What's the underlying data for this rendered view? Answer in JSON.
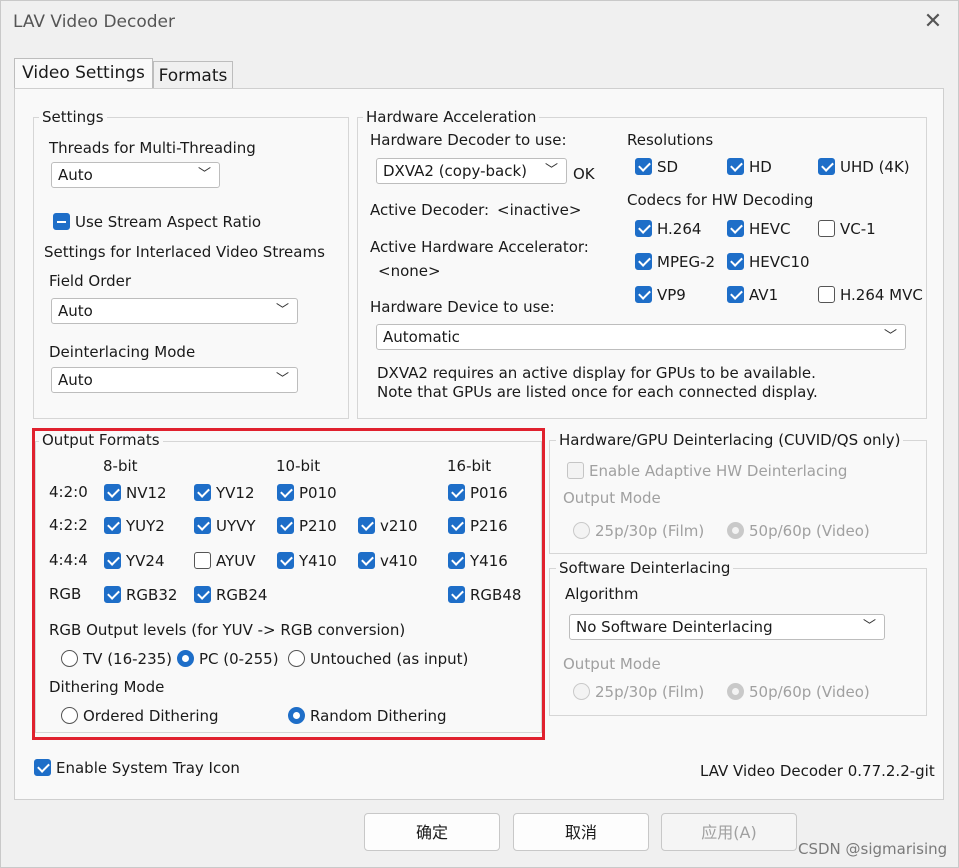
{
  "window": {
    "title": "LAV Video Decoder"
  },
  "tabs": [
    {
      "label": "Video Settings",
      "active": true
    },
    {
      "label": "Formats",
      "active": false
    }
  ],
  "settings": {
    "title": "Settings",
    "threads_label": "Threads for Multi-Threading",
    "threads_value": "Auto",
    "stream_aspect": {
      "label": "Use Stream Aspect Ratio",
      "state": "indeterminate"
    },
    "interlaced_label": "Settings for Interlaced Video Streams",
    "field_order_label": "Field Order",
    "field_order_value": "Auto",
    "deinterlacing_label": "Deinterlacing Mode",
    "deinterlacing_value": "Auto"
  },
  "hw": {
    "title": "Hardware Acceleration",
    "decoder_label": "Hardware Decoder to use:",
    "decoder_value": "DXVA2 (copy-back)",
    "decoder_status": "OK",
    "active_decoder_label": "Active Decoder:",
    "active_decoder_value": "<inactive>",
    "active_accel_label": "Active Hardware Accelerator:",
    "active_accel_value": "<none>",
    "device_label": "Hardware Device to use:",
    "device_value": "Automatic",
    "note_line1": "DXVA2 requires an active display for GPUs to be available.",
    "note_line2": "Note that GPUs are listed once for each connected display.",
    "resolutions_label": "Resolutions",
    "resolutions": [
      {
        "label": "SD",
        "checked": true
      },
      {
        "label": "HD",
        "checked": true
      },
      {
        "label": "UHD (4K)",
        "checked": true
      }
    ],
    "codecs_label": "Codecs for HW Decoding",
    "codecs": [
      {
        "label": "H.264",
        "checked": true
      },
      {
        "label": "HEVC",
        "checked": true
      },
      {
        "label": "VC-1",
        "checked": false
      },
      {
        "label": "MPEG-2",
        "checked": true
      },
      {
        "label": "HEVC10",
        "checked": true
      },
      {
        "label": "VP9",
        "checked": true
      },
      {
        "label": "AV1",
        "checked": true
      },
      {
        "label": "H.264 MVC",
        "checked": false
      }
    ]
  },
  "output": {
    "title": "Output Formats",
    "col_8bit": "8-bit",
    "col_10bit": "10-bit",
    "col_16bit": "16-bit",
    "rows": [
      "4:2:0",
      "4:2:2",
      "4:4:4",
      "RGB"
    ],
    "formats": [
      {
        "label": "NV12",
        "checked": true
      },
      {
        "label": "YV12",
        "checked": true
      },
      {
        "label": "P010",
        "checked": true
      },
      {
        "label": "P016",
        "checked": true
      },
      {
        "label": "YUY2",
        "checked": true
      },
      {
        "label": "UYVY",
        "checked": true
      },
      {
        "label": "P210",
        "checked": true
      },
      {
        "label": "v210",
        "checked": true
      },
      {
        "label": "P216",
        "checked": true
      },
      {
        "label": "YV24",
        "checked": true
      },
      {
        "label": "AYUV",
        "checked": false
      },
      {
        "label": "Y410",
        "checked": true
      },
      {
        "label": "v410",
        "checked": true
      },
      {
        "label": "Y416",
        "checked": true
      },
      {
        "label": "RGB32",
        "checked": true
      },
      {
        "label": "RGB24",
        "checked": true
      },
      {
        "label": "RGB48",
        "checked": true
      }
    ],
    "levels_label": "RGB Output levels (for YUV -> RGB conversion)",
    "levels": [
      {
        "label": "TV (16-235)",
        "selected": false
      },
      {
        "label": "PC (0-255)",
        "selected": true
      },
      {
        "label": "Untouched (as input)",
        "selected": false
      }
    ],
    "dither_label": "Dithering Mode",
    "dither": [
      {
        "label": "Ordered Dithering",
        "selected": false
      },
      {
        "label": "Random Dithering",
        "selected": true
      }
    ]
  },
  "hwdeint": {
    "title": "Hardware/GPU Deinterlacing (CUVID/QS only)",
    "adaptive_label": "Enable Adaptive HW Deinterlacing",
    "output_mode_label": "Output Mode",
    "film": "25p/30p (Film)",
    "video": "50p/60p (Video)"
  },
  "swdeint": {
    "title": "Software Deinterlacing",
    "algorithm_label": "Algorithm",
    "algorithm_value": "No Software Deinterlacing",
    "output_mode_label": "Output Mode",
    "film": "25p/30p (Film)",
    "video": "50p/60p (Video)"
  },
  "tray": {
    "label": "Enable System Tray Icon",
    "checked": true
  },
  "version": "LAV Video Decoder 0.77.2.2-git",
  "buttons": {
    "ok": "确定",
    "cancel": "取消",
    "apply": "应用(A)"
  },
  "watermark": "CSDN @sigmarising",
  "icons": {
    "close": "close-icon",
    "dropdown": "chevron-down-icon"
  },
  "colors": {
    "accent": "#1e6ec8",
    "highlight": "#e0212e"
  }
}
